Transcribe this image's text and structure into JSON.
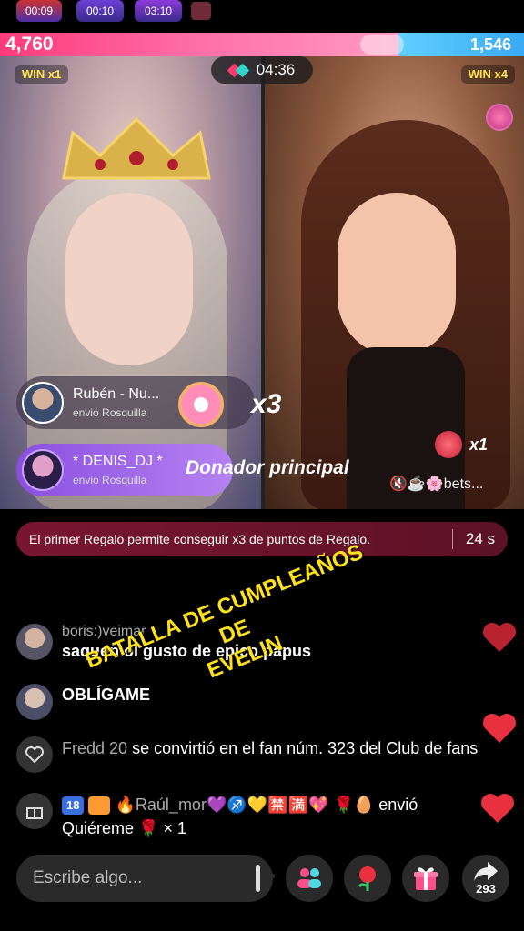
{
  "top_chips": [
    "00:09",
    "00:10",
    "03:10"
  ],
  "score": {
    "left": "4,760",
    "right": "1,546",
    "left_fraction": 0.76
  },
  "battle": {
    "timer": "04:36",
    "left_win": "WIN x1",
    "right_win": "WIN x4"
  },
  "gifts": {
    "notice1": {
      "name": "Rubén - Nu...",
      "sub": "envió Rosquilla"
    },
    "notice2": {
      "name": "* DENIS_DJ *",
      "sub": "envió Rosquilla"
    },
    "multiplier": "x3",
    "donor_label": "Donador principal",
    "rose_count": "x1",
    "mini_gifts": "🔇☕🌸bets..."
  },
  "banner": {
    "text": "El primer Regalo permite conseguir x3 de puntos de Regalo.",
    "time": "24 s"
  },
  "overlay": {
    "line1": "BATALLA DE CUMPLEAÑOS",
    "line2": "DE",
    "line3": "EVELIN"
  },
  "chat": [
    {
      "user": "boris:)veimar",
      "msg": "saquen ol gusto de epico papus"
    },
    {
      "user": "",
      "msg": "OBLÍGAME"
    }
  ],
  "fan_notice": {
    "name": "Fredd 20",
    "text": "se convirtió en el fan núm. 323 del Club de fans"
  },
  "gift_line": {
    "badge_level": "18",
    "user": "🔥Raúl_mor💜♐💛🈲🈵💖",
    "action": "🌹🥚 envió",
    "text": "Quiéreme 🌹 × 1"
  },
  "input": {
    "placeholder": "Escribe algo..."
  },
  "share_count": "293",
  "colors": {
    "accent_pink": "#ff3b7a",
    "accent_blue": "#3aa9f5",
    "overlay_yellow": "#ffe11a",
    "heart_red": "#e8303e"
  }
}
